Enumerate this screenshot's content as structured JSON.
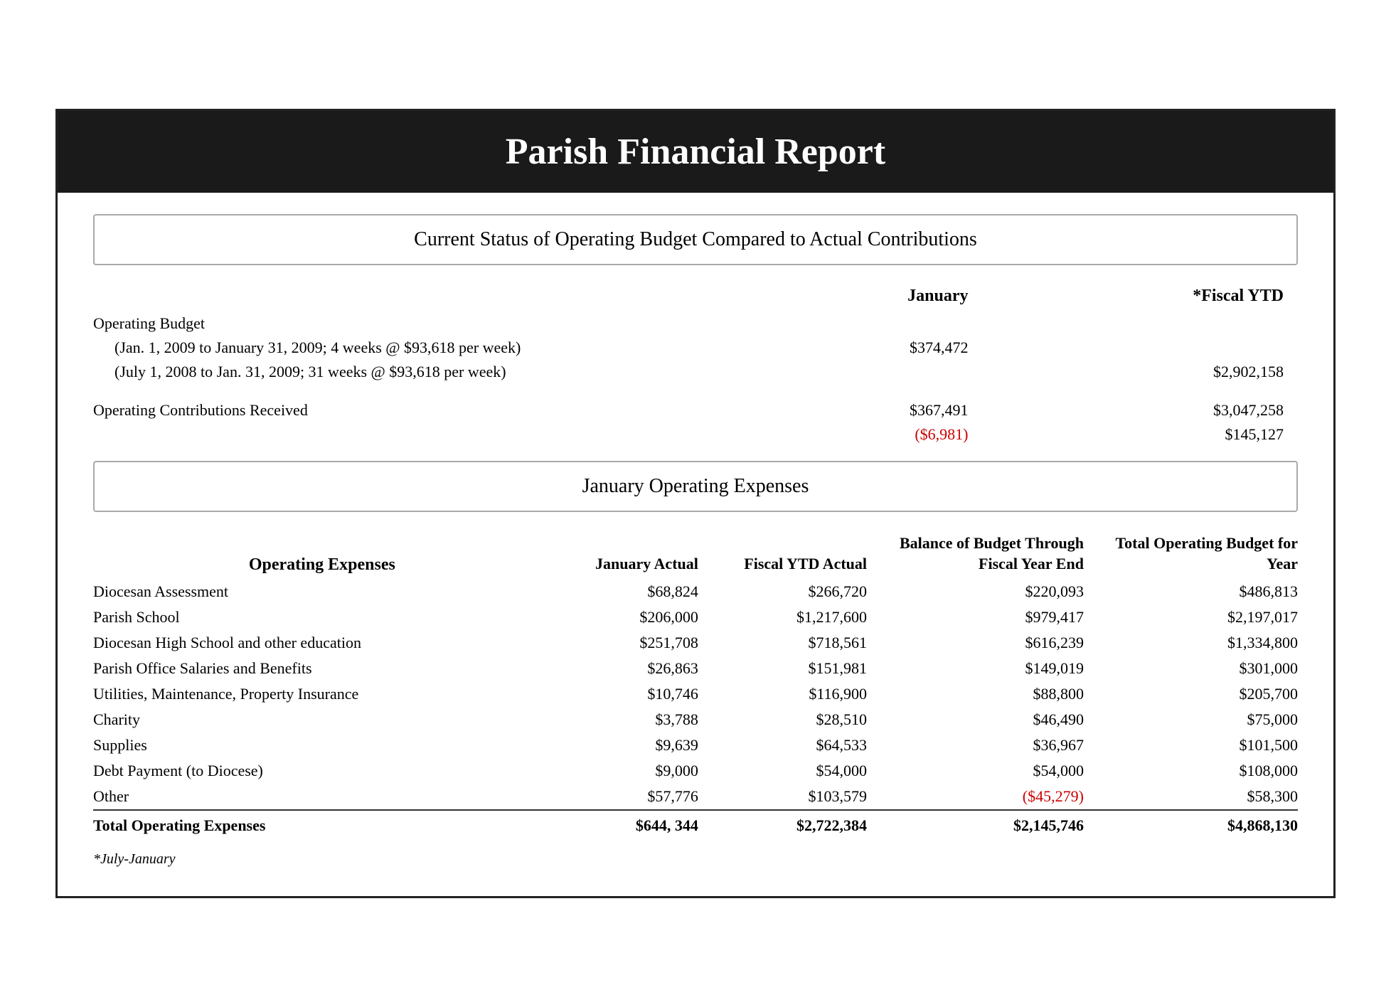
{
  "header": {
    "title": "Parish Financial Report"
  },
  "section1": {
    "title": "Current Status of Operating Budget Compared to Actual Contributions"
  },
  "columns": {
    "january": "January",
    "fiscal_ytd": "*Fiscal YTD"
  },
  "operating_budget": {
    "label": "Operating Budget",
    "row1_label": "(Jan. 1, 2009 to January 31, 2009; 4 weeks @ $93,618 per week)",
    "row1_jan": "$374,472",
    "row2_label": "(July 1, 2008 to Jan. 31, 2009; 31 weeks @ $93,618 per week)",
    "row2_ytd": "$2,902,158",
    "contributions_label": "Operating Contributions Received",
    "contributions_jan": "$367,491",
    "contributions_ytd": "$3,047,258",
    "diff_jan": "($6,981)",
    "diff_ytd": "$145,127"
  },
  "section2": {
    "title": "January Operating Expenses"
  },
  "expenses_headers": {
    "col_name": "Operating Expenses",
    "col_jan": "January Actual",
    "col_ytd": "Fiscal YTD Actual",
    "col_balance": "Balance of Budget Through Fiscal Year End",
    "col_total": "Total Operating Budget for Year"
  },
  "expenses": [
    {
      "name": "Diocesan Assessment",
      "jan": "$68,824",
      "ytd": "$266,720",
      "balance": "$220,093",
      "total": "$486,813"
    },
    {
      "name": "Parish School",
      "jan": "$206,000",
      "ytd": "$1,217,600",
      "balance": "$979,417",
      "total": "$2,197,017"
    },
    {
      "name": "Diocesan High School and other education",
      "jan": "$251,708",
      "ytd": "$718,561",
      "balance": "$616,239",
      "total": "$1,334,800"
    },
    {
      "name": "Parish Office Salaries and Benefits",
      "jan": "$26,863",
      "ytd": "$151,981",
      "balance": "$149,019",
      "total": "$301,000"
    },
    {
      "name": "Utilities, Maintenance, Property Insurance",
      "jan": "$10,746",
      "ytd": "$116,900",
      "balance": "$88,800",
      "total": "$205,700"
    },
    {
      "name": "Charity",
      "jan": "$3,788",
      "ytd": "$28,510",
      "balance": "$46,490",
      "total": "$75,000"
    },
    {
      "name": "Supplies",
      "jan": "$9,639",
      "ytd": "$64,533",
      "balance": "$36,967",
      "total": "$101,500"
    },
    {
      "name": "Debt Payment (to Diocese)",
      "jan": "$9,000",
      "ytd": "$54,000",
      "balance": "$54,000",
      "total": "$108,000"
    },
    {
      "name": "Other",
      "jan": "$57,776",
      "ytd": "$103,579",
      "balance": "($45,279)",
      "balance_negative": true,
      "total": "$58,300"
    }
  ],
  "totals": {
    "label": "Total Operating Expenses",
    "jan": "$644, 344",
    "ytd": "$2,722,384",
    "balance": "$2,145,746",
    "total": "$4,868,130"
  },
  "footnote": "*July-January"
}
